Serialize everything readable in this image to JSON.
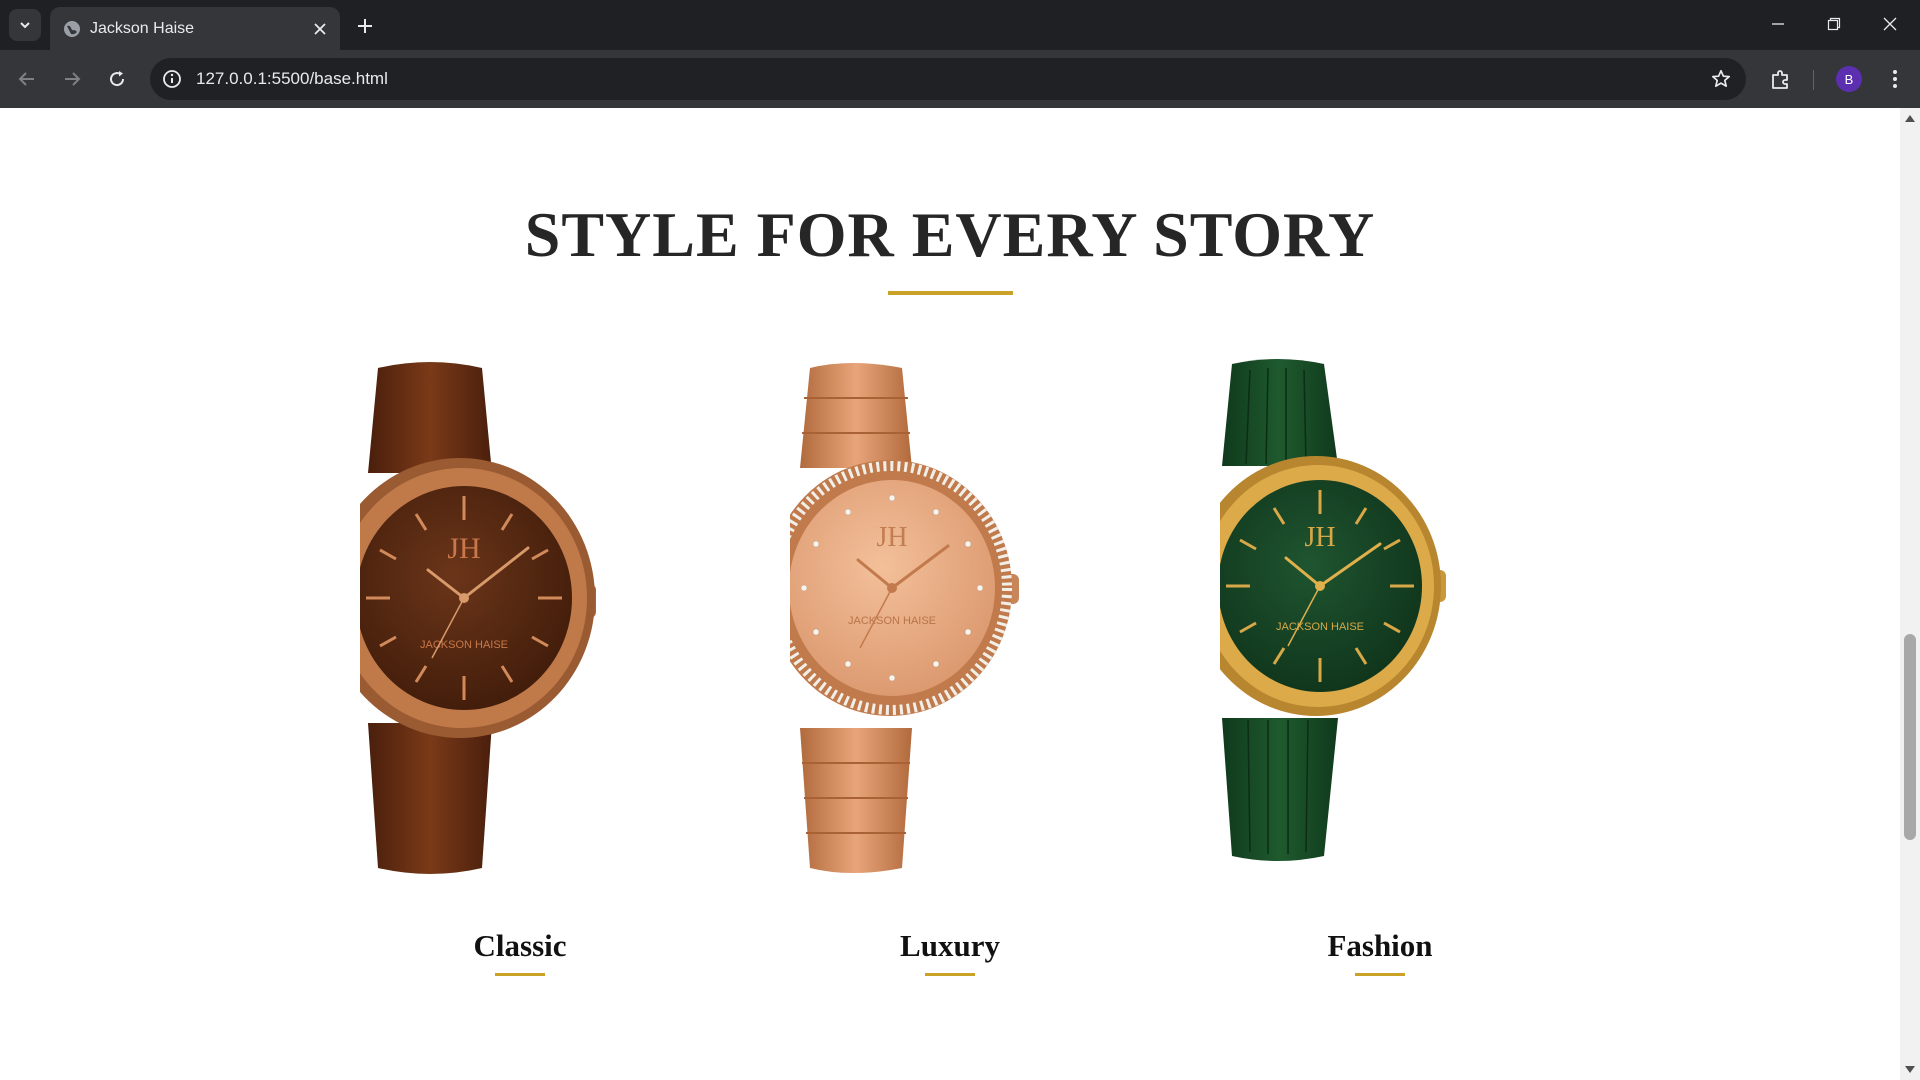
{
  "browser": {
    "tab_title": "Jackson Haise",
    "url": "127.0.0.1:5500/base.html",
    "profile_initial": "B"
  },
  "page": {
    "title": "STYLE FOR EVERY STORY",
    "collections": [
      {
        "label": "Classic",
        "dial_logo": "JH",
        "dial_brand": "JACKSON HAISE",
        "strap": "brown-leather",
        "dial_color": "#5a2c15",
        "case_color": "#b8703f"
      },
      {
        "label": "Luxury",
        "dial_logo": "JH",
        "dial_brand": "JACKSON HAISE",
        "strap": "rose-gold-bracelet",
        "dial_color": "#e4a67a",
        "case_color": "#d38a5a"
      },
      {
        "label": "Fashion",
        "dial_logo": "JH",
        "dial_brand": "JACKSON HAISE",
        "strap": "green-rubber",
        "dial_color": "#1c4a2a",
        "case_color": "#c99b3b"
      }
    ]
  },
  "colors": {
    "accent_gold": "#c9a227",
    "title_text": "#262626",
    "chrome_dark": "#1f2023",
    "chrome_toolbar": "#35363a"
  },
  "icons": {
    "tab_search": "chevron-down-icon",
    "favicon": "globe-icon",
    "tab_close": "close-icon",
    "new_tab": "plus-icon",
    "back": "arrow-left-icon",
    "forward": "arrow-right-icon",
    "reload": "reload-icon",
    "site_info": "info-icon",
    "bookmark": "star-icon",
    "extensions": "puzzle-icon",
    "menu": "kebab-menu-icon"
  }
}
